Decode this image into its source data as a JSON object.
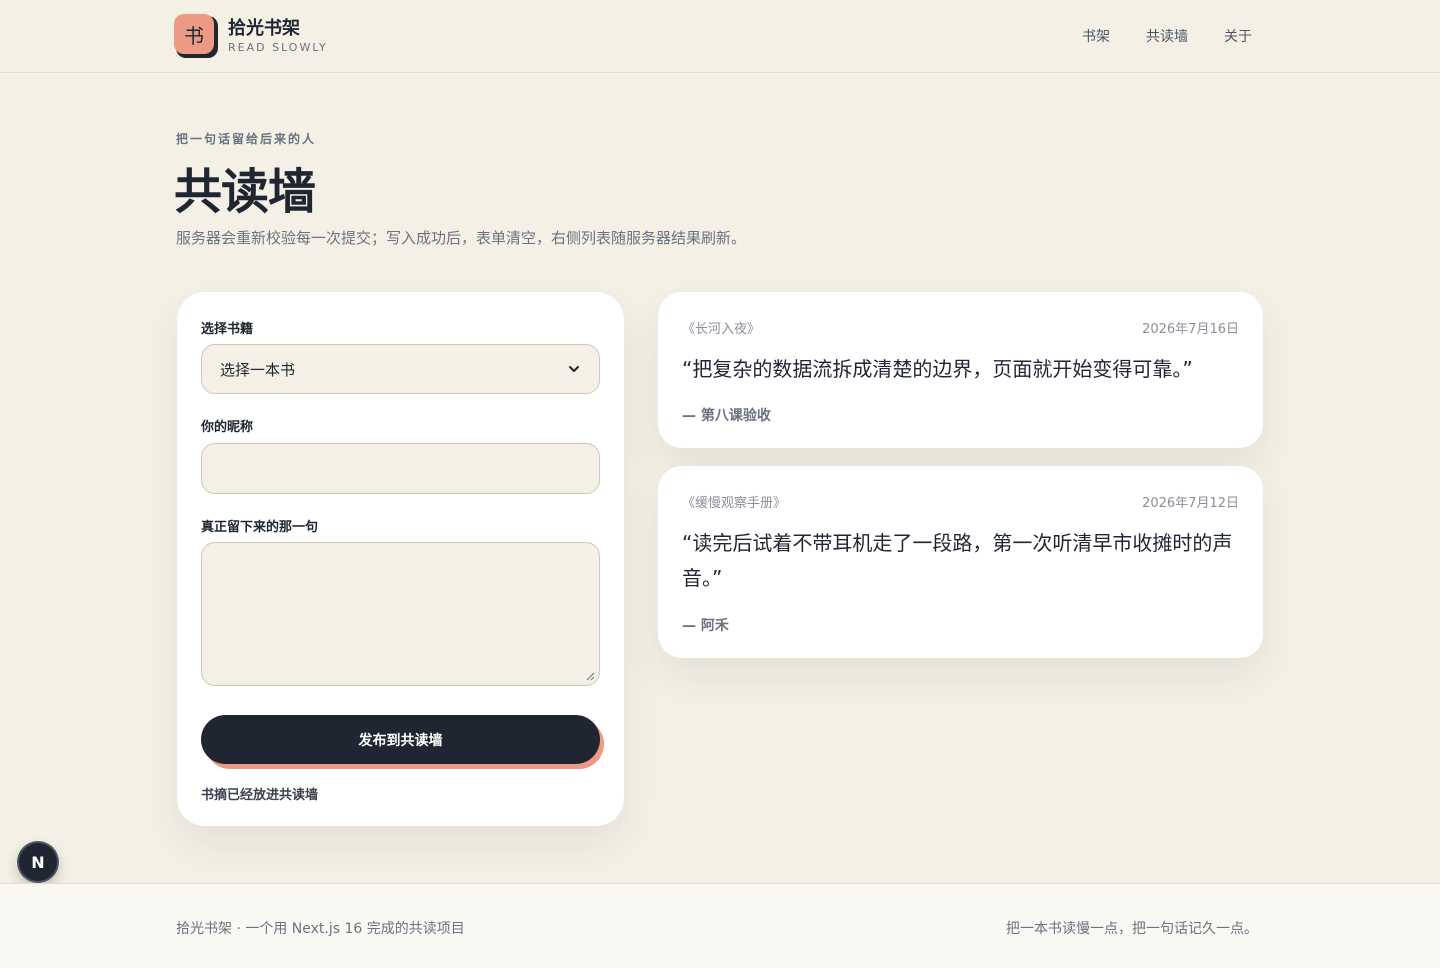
{
  "header": {
    "logo_glyph": "书",
    "brand_title": "拾光书架",
    "brand_subtitle": "READ SLOWLY",
    "nav": [
      "书架",
      "共读墙",
      "关于"
    ]
  },
  "hero": {
    "eyebrow": "把一句话留给后来的人",
    "title": "共读墙",
    "description": "服务器会重新校验每一次提交；写入成功后，表单清空，右侧列表随服务器结果刷新。"
  },
  "form": {
    "book_label": "选择书籍",
    "book_value": "选择一本书",
    "nickname_label": "你的昵称",
    "nickname_value": "",
    "quote_label": "真正留下来的那一句",
    "quote_value": "",
    "submit_label": "发布到共读墙",
    "status_message": "书摘已经放进共读墙"
  },
  "quotes": [
    {
      "book": "《长河入夜》",
      "date": "2026年7月16日",
      "text": "“把复杂的数据流拆成清楚的边界，页面就开始变得可靠。”",
      "author": "— 第八课验收"
    },
    {
      "book": "《缓慢观察手册》",
      "date": "2026年7月12日",
      "text": "“读完后试着不带耳机走了一段路，第一次听清早市收摊时的声音。”",
      "author": "— 阿禾"
    }
  ],
  "badge": {
    "letter": "N"
  },
  "footer": {
    "left": "拾光书架 · 一个用 Next.js 16 完成的共读项目",
    "right": "把一本书读慢一点，把一句话记久一点。"
  },
  "colors": {
    "background": "#f4f0e6",
    "accent": "#ec9a84",
    "ink": "#1f2632",
    "card": "#ffffff"
  }
}
